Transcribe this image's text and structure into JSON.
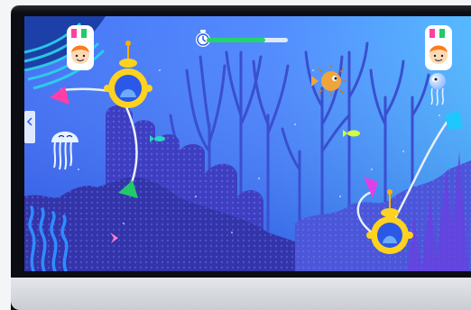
{
  "game": {
    "progress_fraction": 0.72,
    "left_player": {
      "avatar_icon": "boy-avatar-icon",
      "badge_icon": "waving-hands-icon"
    },
    "right_player": {
      "avatar_icon": "boy-avatar-icon",
      "badge_icon": "waving-hands-icon"
    },
    "timer_icon": "clock-icon",
    "side_tab_icon": "chevron-left-icon"
  },
  "colors": {
    "water_left": "#2f6dff",
    "water_right": "#3aa6ff",
    "reef_dark": "#3b3ab8",
    "sub_yellow": "#ffd21f",
    "progress_green": "#23d46d",
    "claw_pink": "#ff3fa6",
    "claw_green": "#22c96a",
    "claw_cyan": "#1ec8ff",
    "claw_magenta": "#e040e8"
  }
}
